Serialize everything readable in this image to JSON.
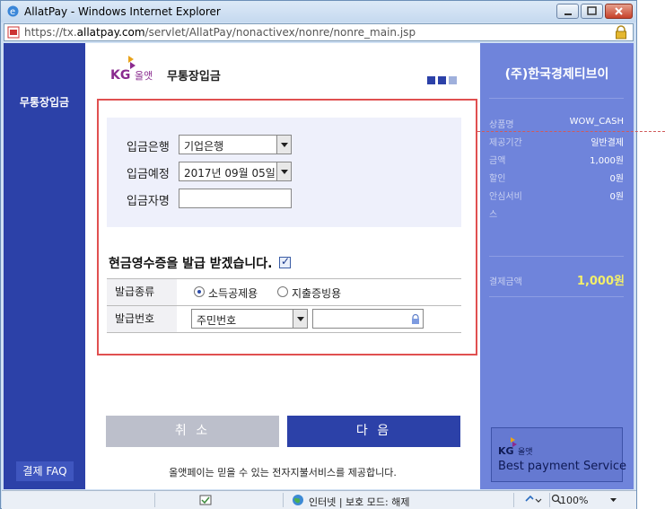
{
  "window": {
    "title": "AllatPay - Windows Internet Explorer",
    "url_prefix": "https://tx.",
    "url_host": "allatpay.com",
    "url_path": "/servlet/AllatPay/nonactivex/nonre/nonre_main.jsp"
  },
  "leftnav": {
    "item": "무통장입금",
    "faq": "결제 FAQ"
  },
  "header": {
    "logo_text": "KG 올앳",
    "title": "무통장입금"
  },
  "form": {
    "bank_label": "입금은행",
    "bank_value": "기업은행",
    "date_label": "입금예정",
    "date_value": "2017년 09월 05일",
    "depositor_label": "입금자명",
    "depositor_value": "",
    "receipt_question": "현금영수증을 발급 받겠습니다.",
    "receipt_checked": true,
    "type_label": "발급종류",
    "type_option_1": "소득공제용",
    "type_option_2": "지출증빙용",
    "number_label": "발급번호",
    "number_type": "주민번호",
    "number_value": ""
  },
  "buttons": {
    "cancel": "취 소",
    "next": "다 음"
  },
  "footer_note": "올앳페이는 믿을 수 있는 전자지불서비스를 제공합니다.",
  "summary": {
    "merchant": "(주)한국경제티브이",
    "rows": [
      {
        "k": "상품명",
        "v": "WOW_CASH"
      },
      {
        "k": "제공기간",
        "v": "일반결제"
      },
      {
        "k": "금액",
        "v": "1,000원"
      },
      {
        "k": "할인",
        "v": "0원"
      },
      {
        "k": "안심서비",
        "v": "0원"
      },
      {
        "k": "스",
        "v": ""
      }
    ],
    "total_label": "결제금액",
    "total_value": "1,000원",
    "banner_logo": "KG 올앳",
    "banner_tag": "Best payment Service"
  },
  "statusbar": {
    "zone": "인터넷 | 보호 모드: 해제",
    "zoom": "100%"
  },
  "colors": {
    "primary": "#2c41a8",
    "sidebar_right": "#6f84db",
    "highlight_border": "#e05050",
    "total_value": "#f3ef6a"
  }
}
